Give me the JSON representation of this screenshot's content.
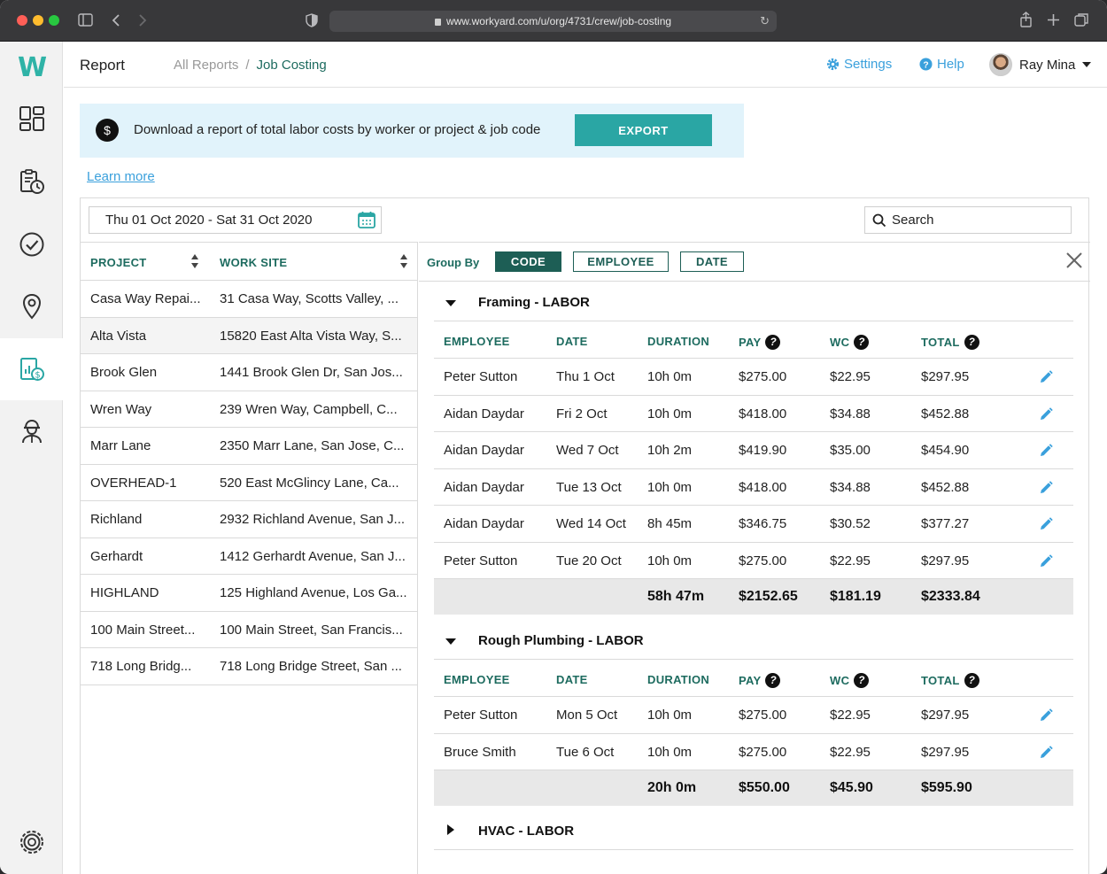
{
  "browser": {
    "url": "www.workyard.com/u/org/4731/crew/job-costing"
  },
  "sidebar": {
    "logo": "W",
    "items": [
      {
        "icon": "dashboard-icon"
      },
      {
        "icon": "timesheet-clock-icon"
      },
      {
        "icon": "check-circle-icon"
      },
      {
        "icon": "location-pin-icon"
      },
      {
        "icon": "reports-dollar-icon",
        "active": true
      },
      {
        "icon": "worker-hardhat-icon"
      },
      {
        "icon": "settings-gear-icon"
      }
    ]
  },
  "header": {
    "title": "Report",
    "breadcrumb_parent": "All Reports",
    "breadcrumb_sep": "/",
    "breadcrumb_current": "Job Costing",
    "settings_label": "Settings",
    "help_label": "Help",
    "user_name": "Ray Mina"
  },
  "banner": {
    "icon": "$",
    "text": "Download a report of total labor costs by worker or project & job code",
    "export_label": "EXPORT"
  },
  "learn_more": "Learn more",
  "filters": {
    "date_range": "Thu 01 Oct 2020 - Sat 31 Oct 2020",
    "search_placeholder": "Search"
  },
  "projects": {
    "columns": [
      "PROJECT",
      "WORK SITE"
    ],
    "rows": [
      {
        "project": "Casa Way Repai...",
        "site": "31 Casa Way, Scotts Valley, ..."
      },
      {
        "project": "Alta Vista",
        "site": "15820 East Alta Vista Way, S...",
        "selected": true
      },
      {
        "project": "Brook Glen",
        "site": "1441 Brook Glen Dr, San Jos..."
      },
      {
        "project": "Wren Way",
        "site": "239 Wren Way, Campbell, C..."
      },
      {
        "project": "Marr Lane",
        "site": "2350 Marr Lane, San Jose, C..."
      },
      {
        "project": "OVERHEAD-1",
        "site": "520 East McGlincy Lane, Ca..."
      },
      {
        "project": "Richland",
        "site": "2932 Richland Avenue, San J..."
      },
      {
        "project": "Gerhardt",
        "site": "1412 Gerhardt Avenue, San J..."
      },
      {
        "project": "HIGHLAND",
        "site": "125 Highland Avenue, Los Ga..."
      },
      {
        "project": "100 Main Street...",
        "site": "100 Main Street, San Francis..."
      },
      {
        "project": "718 Long Bridg...",
        "site": "718 Long Bridge Street, San ..."
      }
    ]
  },
  "group_by": {
    "label": "Group By",
    "options": [
      "CODE",
      "EMPLOYEE",
      "DATE"
    ],
    "active": "CODE"
  },
  "detail_columns": [
    "EMPLOYEE",
    "DATE",
    "DURATION",
    "PAY",
    "WC",
    "TOTAL"
  ],
  "help_mark": "?",
  "sections": [
    {
      "title": "Framing - LABOR",
      "expanded": true,
      "rows": [
        {
          "employee": "Peter Sutton",
          "date": "Thu 1 Oct",
          "duration": "10h 0m",
          "pay": "$275.00",
          "wc": "$22.95",
          "total": "$297.95"
        },
        {
          "employee": "Aidan Daydar",
          "date": "Fri 2 Oct",
          "duration": "10h 0m",
          "pay": "$418.00",
          "wc": "$34.88",
          "total": "$452.88"
        },
        {
          "employee": "Aidan Daydar",
          "date": "Wed 7 Oct",
          "duration": "10h 2m",
          "pay": "$419.90",
          "wc": "$35.00",
          "total": "$454.90"
        },
        {
          "employee": "Aidan Daydar",
          "date": "Tue 13 Oct",
          "duration": "10h 0m",
          "pay": "$418.00",
          "wc": "$34.88",
          "total": "$452.88"
        },
        {
          "employee": "Aidan Daydar",
          "date": "Wed 14 Oct",
          "duration": "8h 45m",
          "pay": "$346.75",
          "wc": "$30.52",
          "total": "$377.27"
        },
        {
          "employee": "Peter Sutton",
          "date": "Tue 20 Oct",
          "duration": "10h 0m",
          "pay": "$275.00",
          "wc": "$22.95",
          "total": "$297.95"
        }
      ],
      "totals": {
        "duration": "58h 47m",
        "pay": "$2152.65",
        "wc": "$181.19",
        "total": "$2333.84"
      }
    },
    {
      "title": "Rough Plumbing - LABOR",
      "expanded": true,
      "rows": [
        {
          "employee": "Peter Sutton",
          "date": "Mon 5 Oct",
          "duration": "10h 0m",
          "pay": "$275.00",
          "wc": "$22.95",
          "total": "$297.95"
        },
        {
          "employee": "Bruce Smith",
          "date": "Tue 6 Oct",
          "duration": "10h 0m",
          "pay": "$275.00",
          "wc": "$22.95",
          "total": "$297.95"
        }
      ],
      "totals": {
        "duration": "20h 0m",
        "pay": "$550.00",
        "wc": "$45.90",
        "total": "$595.90"
      }
    },
    {
      "title": "HVAC - LABOR",
      "expanded": false
    }
  ],
  "colors": {
    "teal_accent": "#2aa6a4",
    "dark_green": "#1d5e55",
    "link_blue": "#3aa0dc",
    "banner_bg": "#e1f3fb"
  }
}
